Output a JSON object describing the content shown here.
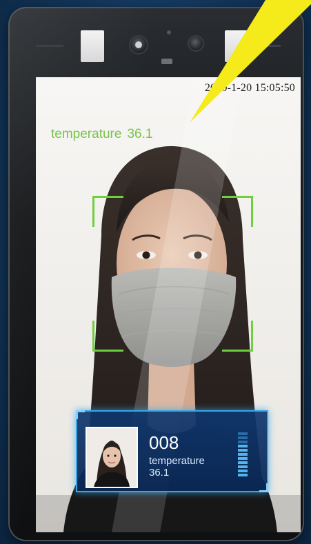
{
  "screen": {
    "timestamp": "2020-1-20  15:05:50",
    "temperature_label": "temperature",
    "temperature_value": "36.1"
  },
  "record_card": {
    "id": "008",
    "temperature_label": "temperature",
    "temperature_value": "36.1"
  },
  "colors": {
    "detection_frame": "#6fcf3f",
    "temperature_text": "#78c348",
    "card_border": "#3aa6e6",
    "beam": "#f5ea1a"
  },
  "icons": [
    "camera-icon",
    "ir-sensor-icon"
  ]
}
